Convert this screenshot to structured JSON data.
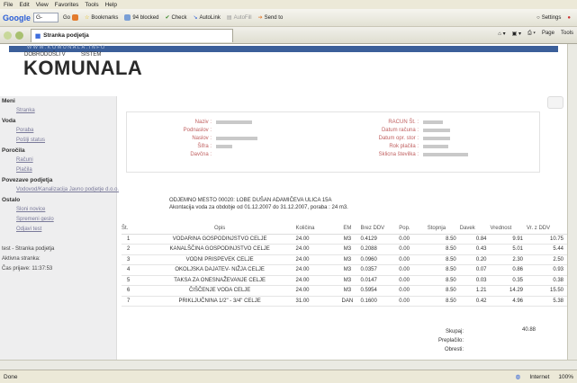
{
  "menu": [
    "File",
    "Edit",
    "View",
    "Favorites",
    "Tools",
    "Help"
  ],
  "toolbar": {
    "google_logo": "Google",
    "google_box": "G-",
    "go_label": "Go",
    "bookmarks": "Bookmarks",
    "blocked": "94 blocked",
    "check": "Check",
    "autolink": "AutoLink",
    "autofill": "AutoFill",
    "sendto": "Send to",
    "settings": "Settings"
  },
  "tab": {
    "title": "Stranka podjetja"
  },
  "tabtools": {
    "page": "Page",
    "tools": "Tools"
  },
  "header": {
    "url": "WWW.KOMUNALA.INFO",
    "tagline1": "DOBRODOŠLI V",
    "tagline2": "SISTEM",
    "logo": "KOMUNALA"
  },
  "sidebar": [
    {
      "type": "sec",
      "text": "Meni"
    },
    {
      "type": "lnk",
      "text": "Stranka"
    },
    {
      "type": "sec",
      "text": "Voda"
    },
    {
      "type": "lnk",
      "text": "Poraba"
    },
    {
      "type": "lnk",
      "text": "Pošlji status"
    },
    {
      "type": "sec",
      "text": "Poročila"
    },
    {
      "type": "lnk",
      "text": "Računi"
    },
    {
      "type": "lnk",
      "text": "Plačila"
    },
    {
      "type": "sec",
      "text": "Povezave podjetja"
    },
    {
      "type": "lnk",
      "text": "Vodovod/Kanalizacija Javno podjetje d.o.o."
    },
    {
      "type": "sec",
      "text": "Ostalo"
    },
    {
      "type": "lnk",
      "text": "Sloni novice"
    },
    {
      "type": "lnk",
      "text": "Spremeni geslo"
    },
    {
      "type": "lnk",
      "text": "Odjavi test"
    },
    {
      "type": "plain",
      "text": ""
    },
    {
      "type": "plain",
      "text": "test - Stranka podjetja"
    },
    {
      "type": "plain",
      "text": "Aktivna stranka:"
    },
    {
      "type": "plain",
      "text": "Čas prijave: 11:37:53"
    }
  ],
  "info_left": [
    "Naziv :",
    "Podnaslov :",
    "Naslov :",
    "Šifra :",
    "Davčna :"
  ],
  "info_right": [
    "RACUN Št. :",
    "Datum računa :",
    "Datum opr. stor :",
    "Rok plačila :",
    "Sklicna številka :"
  ],
  "notice": {
    "line1": "ODJEMNO MESTO 00020: LOBE DUŠAN ADAMIČEVA ULICA 15A",
    "line2": "Akontacija voda za obdobje od 01.12.2007 do 31.12.2007, poraba : 24 m3."
  },
  "table": {
    "headers": [
      "Št.",
      "Opis",
      "Količina",
      "EM",
      "Brez DDV",
      "Pop.",
      "Stopnja",
      "Davek",
      "Vrednost",
      "Vr. z DDV"
    ],
    "rows": [
      [
        "1",
        "VODARINA GOSPODINJSTVO CELJE",
        "24.00",
        "M3",
        "0.4129",
        "0.00",
        "8.50",
        "0.84",
        "9.91",
        "10.75"
      ],
      [
        "2",
        "KANALŠČINA GOSPODINJSTVO CELJE",
        "24.00",
        "M3",
        "0.2088",
        "0.00",
        "8.50",
        "0.43",
        "5.01",
        "5.44"
      ],
      [
        "3",
        "VODNI PRISPEVEK CELJE",
        "24.00",
        "M3",
        "0.0960",
        "0.00",
        "8.50",
        "0.20",
        "2.30",
        "2.50"
      ],
      [
        "4",
        "OKOLJSKA DAJATEV- NIŽJA CELJE",
        "24.00",
        "M3",
        "0.0357",
        "0.00",
        "8.50",
        "0.07",
        "0.86",
        "0.93"
      ],
      [
        "5",
        "TAKSA ZA ONESNAŽEVANJE CELJE",
        "24.00",
        "M3",
        "0.0147",
        "0.00",
        "8.50",
        "0.03",
        "0.35",
        "0.38"
      ],
      [
        "6",
        "ČIŠČENJE VODA CELJE",
        "24.00",
        "M3",
        "0.5954",
        "0.00",
        "8.50",
        "1.21",
        "14.29",
        "15.50"
      ],
      [
        "7",
        "PRIKLJUČNINA 1/2\" - 3/4\" CELJE",
        "31.00",
        "DAN",
        "0.1600",
        "0.00",
        "8.50",
        "0.42",
        "4.96",
        "5.38"
      ]
    ]
  },
  "totals": {
    "labels": [
      "Skupaj:",
      "Preplačilo:",
      "Obresti:"
    ],
    "value": "40.88"
  },
  "status": {
    "left": "Done",
    "zone": "Internet",
    "zoom": "100%"
  }
}
